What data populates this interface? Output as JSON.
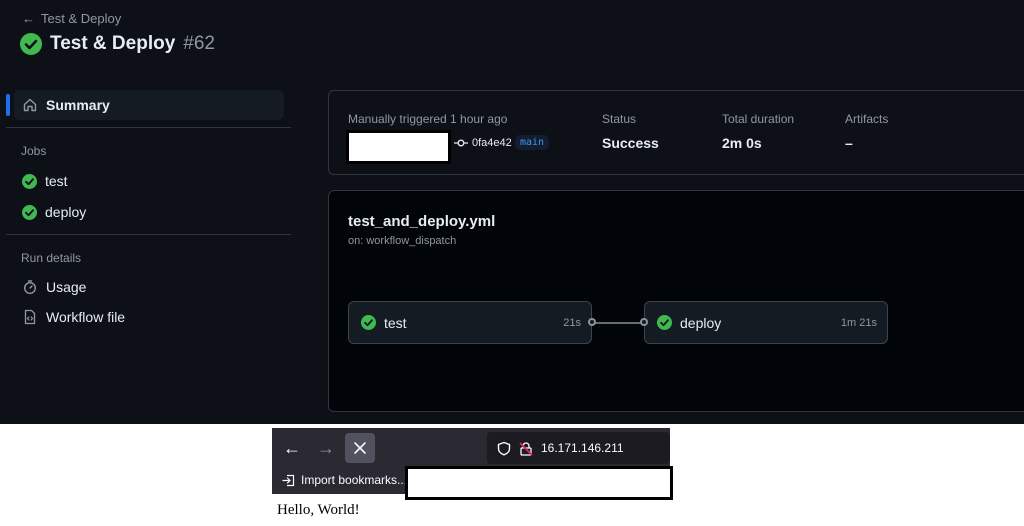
{
  "header": {
    "back_label": "Test & Deploy",
    "title": "Test & Deploy",
    "run_number": "#62"
  },
  "sidebar": {
    "summary_label": "Summary",
    "jobs_heading": "Jobs",
    "jobs": [
      {
        "label": "test",
        "status": "success"
      },
      {
        "label": "deploy",
        "status": "success"
      }
    ],
    "run_details_heading": "Run details",
    "usage_label": "Usage",
    "workflow_file_label": "Workflow file"
  },
  "summary": {
    "trigger_label": "Manually triggered 1 hour ago",
    "commit_sha": "0fa4e42",
    "branch": "main",
    "status_label": "Status",
    "status_value": "Success",
    "duration_label": "Total duration",
    "duration_value": "2m 0s",
    "artifacts_label": "Artifacts",
    "artifacts_value": "–"
  },
  "workflow": {
    "file_name": "test_and_deploy.yml",
    "trigger": "on: workflow_dispatch",
    "jobs": [
      {
        "name": "test",
        "duration": "21s"
      },
      {
        "name": "deploy",
        "duration": "1m 21s"
      }
    ]
  },
  "browser": {
    "url": "16.171.146.211",
    "import_bookmarks_label": "Import bookmarks...",
    "page_text": "Hello, World!"
  },
  "colors": {
    "success": "#3fb950",
    "accent": "#1f6feb",
    "background": "#0d1117"
  }
}
